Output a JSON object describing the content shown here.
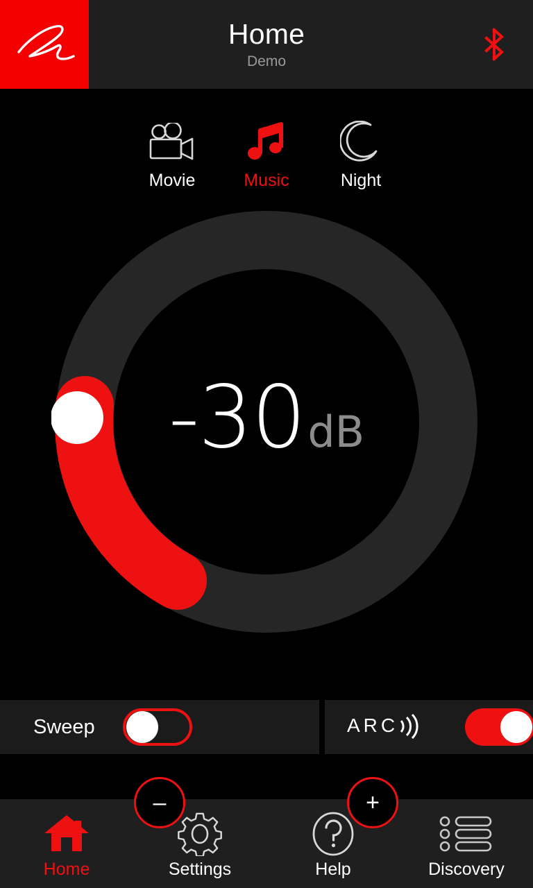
{
  "header": {
    "title": "Home",
    "subtitle": "Demo",
    "brand_logo_icon": "m-signature-logo",
    "bluetooth_icon": "bluetooth-icon",
    "bluetooth_color": "#ee1111",
    "background": "#1f1f1f",
    "brand_color": "#f50000"
  },
  "modes": [
    {
      "id": "movie",
      "label": "Movie",
      "icon": "movie-camera-icon",
      "active": false
    },
    {
      "id": "music",
      "label": "Music",
      "icon": "music-note-icon",
      "active": true
    },
    {
      "id": "night",
      "label": "Night",
      "icon": "moon-icon",
      "active": false
    }
  ],
  "volume": {
    "value": "-30",
    "unit": "dB",
    "minus_label": "–",
    "plus_label": "+",
    "track_color": "#262626",
    "fill_color": "#ee1111",
    "thumb_color": "#ffffff",
    "value_color": "#ffffff",
    "unit_color": "#8c8c8c"
  },
  "toggles": [
    {
      "id": "sweep",
      "label": "Sweep",
      "state": "off",
      "icon": null
    },
    {
      "id": "arc",
      "label": "ARC",
      "state": "on",
      "icon": "arc-waves-logo"
    }
  ],
  "nav": [
    {
      "id": "home",
      "label": "Home",
      "icon": "house-icon",
      "active": true
    },
    {
      "id": "settings",
      "label": "Settings",
      "icon": "gear-icon",
      "active": false
    },
    {
      "id": "help",
      "label": "Help",
      "icon": "question-mark-icon",
      "active": false
    },
    {
      "id": "discovery",
      "label": "Discovery",
      "icon": "list-icon",
      "active": false
    }
  ]
}
